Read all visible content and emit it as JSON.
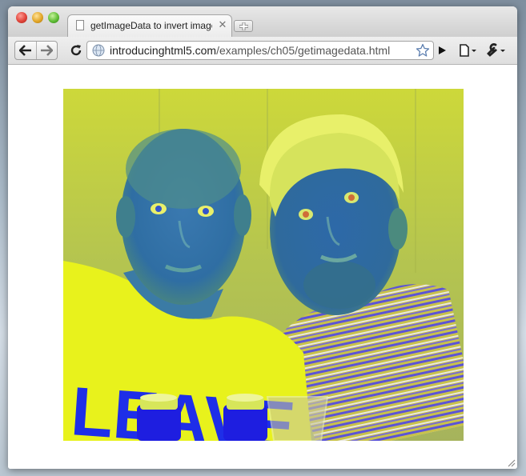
{
  "window": {
    "tab_title": "getImageData to invert image",
    "url_domain": "introducinghtml5.com",
    "url_path": "/examples/ch05/getimagedata.html"
  },
  "icons": {
    "tab_page": "page-icon",
    "tab_close": "close-icon",
    "new_tab": "new-tab-icon",
    "back": "back-arrow-icon",
    "forward": "forward-arrow-icon",
    "reload": "reload-icon",
    "site": "globe-icon",
    "bookmark": "star-icon",
    "play": "play-icon",
    "page_menu": "page-menu-icon",
    "wrench_menu": "wrench-icon"
  },
  "colors": {
    "inverted_yellow": "#e8f11a",
    "inverted_blue": "#2a5fc8",
    "text_blue": "#1e2ee8"
  },
  "image": {
    "text_on_shirt": "LEAVE"
  }
}
